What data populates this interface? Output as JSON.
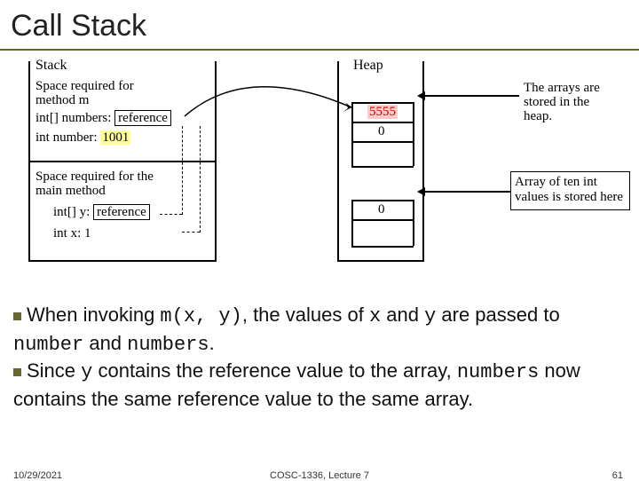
{
  "title": "Call Stack",
  "diagram": {
    "stackTitle": "Stack",
    "heapTitle": "Heap",
    "frameM": {
      "desc1": "Space required for",
      "desc2": "method m",
      "line1a": "int[] numbers:",
      "line1b": "reference",
      "line2a": "int number:",
      "line2b": "1001"
    },
    "frameMain": {
      "desc1": "Space required for the",
      "desc2": "main method",
      "line1a": "int[] y:",
      "line1b": "reference",
      "line2a": "int x: 1"
    },
    "heapTop": "5555",
    "heapZero1": "0",
    "heapZero2": "0",
    "note1a": "The arrays are",
    "note1b": "stored in the",
    "note1c": "heap.",
    "note2a": "Array of ten int",
    "note2b": "values is stored here"
  },
  "bullets": {
    "b1p1": "When invoking ",
    "b1c1": "m(x, y)",
    "b1p2": ", the values of ",
    "b1c2": "x",
    "b1p3": " and ",
    "b1c3": "y",
    "b1p4": " are passed to ",
    "b1c4": "number",
    "b1p5": " and ",
    "b1c5": "numbers",
    "b1p6": ".",
    "b2p1": "Since ",
    "b2c1": "y",
    "b2p2": " contains the reference value to the array, ",
    "b2c2": "numbers",
    "b2p3": " now contains the same reference value to the same array."
  },
  "footer": {
    "date": "10/29/2021",
    "mid": "COSC-1336, Lecture 7",
    "page": "61"
  }
}
